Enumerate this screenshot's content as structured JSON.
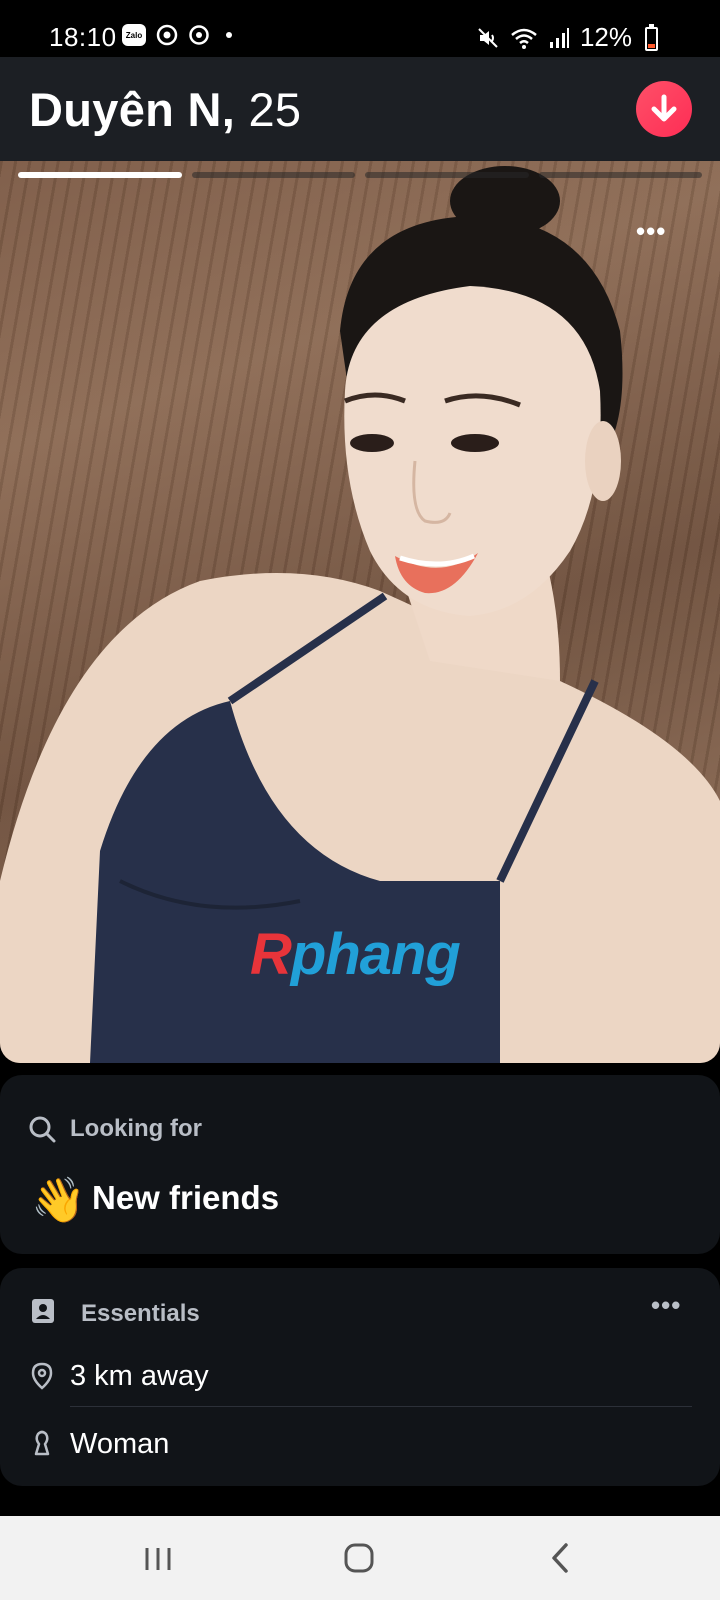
{
  "status_bar": {
    "time": "18:10",
    "app_badge": "Zalo",
    "battery": "12%",
    "icons": [
      "zalo-icon",
      "chrome-icon",
      "sync-icon",
      "dot-icon",
      "mute-icon",
      "wifi-icon",
      "signal-icon",
      "battery-icon"
    ]
  },
  "profile": {
    "name": "Duyên N,",
    "age": "25",
    "photo_count": 4,
    "active_photo_index": 0
  },
  "photo": {
    "watermark_prefix": "R",
    "watermark_rest": "phang"
  },
  "looking_for": {
    "label": "Looking for",
    "emoji": "👋",
    "value": "New friends"
  },
  "essentials": {
    "label": "Essentials",
    "more": "•••",
    "items": [
      {
        "icon": "location-pin-icon",
        "text": "3 km away"
      },
      {
        "icon": "person-icon",
        "text": "Woman"
      }
    ]
  },
  "more_photo": "•••",
  "colors": {
    "accent": "#fd5068",
    "card_bg": "#111418",
    "header_bg": "#1c1f24"
  }
}
